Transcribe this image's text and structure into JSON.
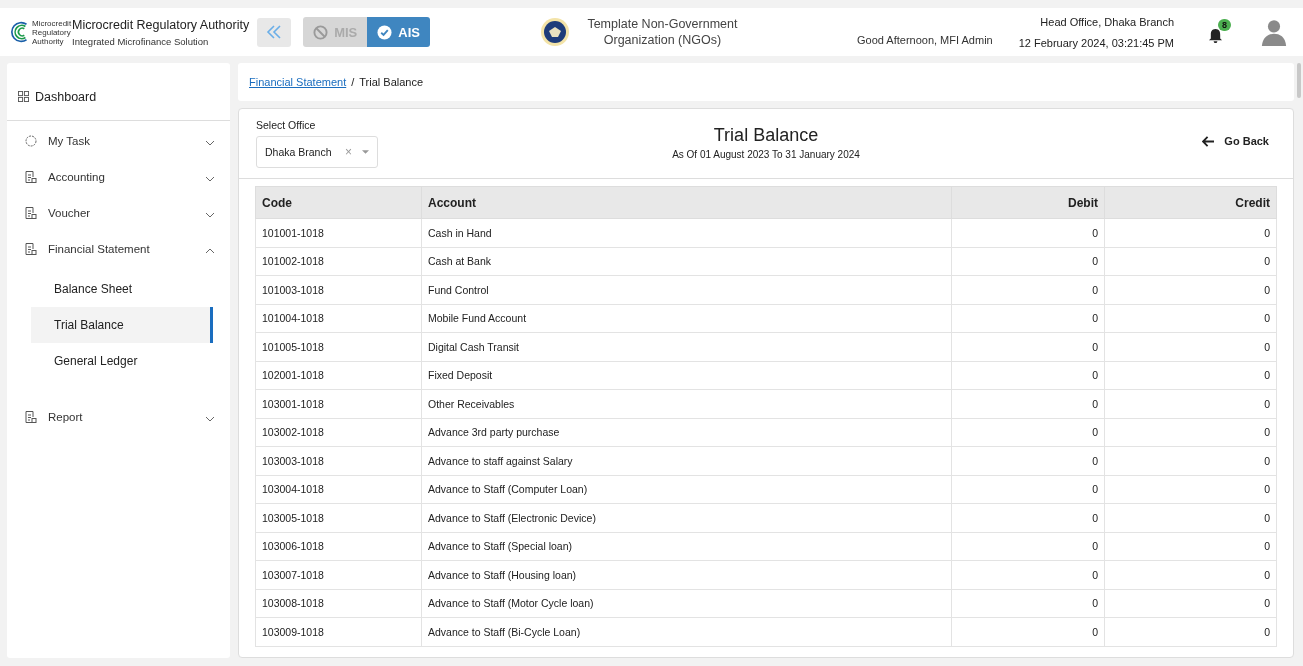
{
  "header": {
    "org_name": "Microcredit Regulatory Authority",
    "org_subtitle": "Integrated Microfinance Solution",
    "logo_text": "Microcredit Regulatory Authority",
    "modules": [
      {
        "label": "MIS",
        "selected": false
      },
      {
        "label": "AIS",
        "selected": true
      }
    ],
    "ngo_name": "Template Non-Government Organization (NGOs)",
    "greeting": "Good Afternoon, MFI Admin",
    "office": "Head Office, Dhaka Branch",
    "datetime": "12 February 2024, 03:21:45 PM",
    "notification_count": "8"
  },
  "sidebar": {
    "dashboard": "Dashboard",
    "items": [
      {
        "label": "My Task",
        "kind": "task",
        "expanded": false
      },
      {
        "label": "Accounting",
        "kind": "module",
        "expanded": false
      },
      {
        "label": "Voucher",
        "kind": "module",
        "expanded": false
      },
      {
        "label": "Financial Statement",
        "kind": "module",
        "expanded": true,
        "children": [
          {
            "label": "Balance Sheet",
            "selected": false
          },
          {
            "label": "Trial Balance",
            "selected": true
          },
          {
            "label": "General Ledger",
            "selected": false
          }
        ]
      },
      {
        "label": "Report",
        "kind": "module",
        "expanded": false
      }
    ]
  },
  "breadcrumb": {
    "link": "Financial Statement",
    "separator": "/",
    "current": "Trial Balance"
  },
  "filter": {
    "label": "Select Office",
    "value": "Dhaka Branch",
    "clear": "×"
  },
  "report": {
    "title": "Trial Balance",
    "period": "As Of 01 August 2023 To 31 January 2024"
  },
  "go_back": "Go Back",
  "table": {
    "columns": [
      "Code",
      "Account",
      "Debit",
      "Credit"
    ],
    "rows": [
      [
        "101001-1018",
        "Cash in Hand",
        "0",
        "0"
      ],
      [
        "101002-1018",
        "Cash at Bank",
        "0",
        "0"
      ],
      [
        "101003-1018",
        "Fund Control",
        "0",
        "0"
      ],
      [
        "101004-1018",
        "Mobile Fund Account",
        "0",
        "0"
      ],
      [
        "101005-1018",
        "Digital Cash Transit",
        "0",
        "0"
      ],
      [
        "102001-1018",
        "Fixed Deposit",
        "0",
        "0"
      ],
      [
        "103001-1018",
        "Other Receivables",
        "0",
        "0"
      ],
      [
        "103002-1018",
        "Advance 3rd party purchase",
        "0",
        "0"
      ],
      [
        "103003-1018",
        "Advance to staff against Salary",
        "0",
        "0"
      ],
      [
        "103004-1018",
        "Advance to Staff (Computer Loan)",
        "0",
        "0"
      ],
      [
        "103005-1018",
        "Advance to Staff (Electronic Device)",
        "0",
        "0"
      ],
      [
        "103006-1018",
        "Advance to Staff (Special loan)",
        "0",
        "0"
      ],
      [
        "103007-1018",
        "Advance to Staff (Housing loan)",
        "0",
        "0"
      ],
      [
        "103008-1018",
        "Advance to Staff (Motor Cycle loan)",
        "0",
        "0"
      ],
      [
        "103009-1018",
        "Advance to Staff (Bi-Cycle Loan)",
        "0",
        "0"
      ]
    ]
  }
}
